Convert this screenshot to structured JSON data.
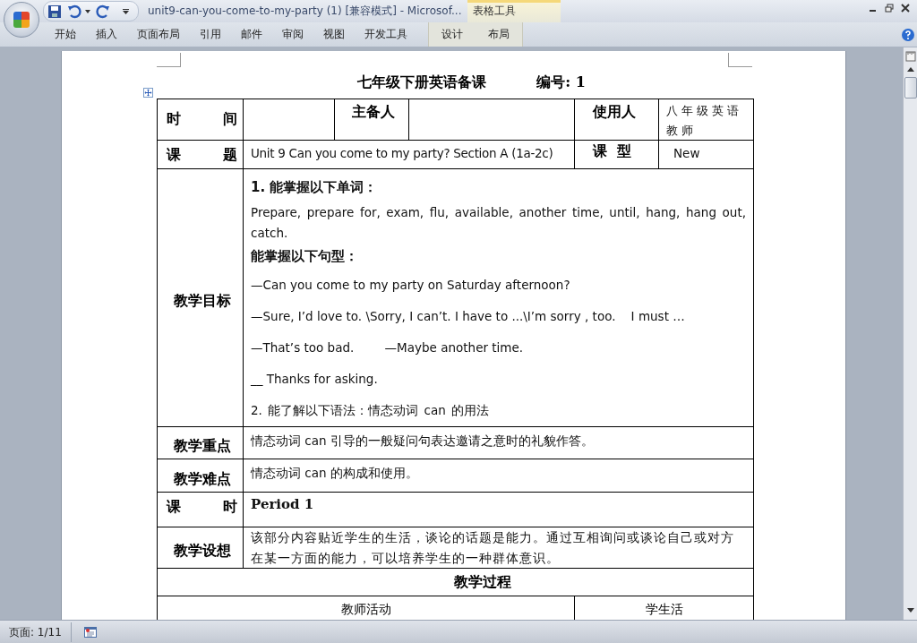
{
  "window": {
    "title": "unit9-can-you-come-to-my-party (1) [兼容模式] - Microsof...",
    "contextual_group": "表格工具"
  },
  "ribbon_tabs": [
    {
      "label": "开始",
      "contextual": false
    },
    {
      "label": "插入",
      "contextual": false
    },
    {
      "label": "页面布局",
      "contextual": false
    },
    {
      "label": "引用",
      "contextual": false
    },
    {
      "label": "邮件",
      "contextual": false
    },
    {
      "label": "审阅",
      "contextual": false
    },
    {
      "label": "视图",
      "contextual": false
    },
    {
      "label": "开发工具",
      "contextual": false
    },
    {
      "label": "设计",
      "contextual": true
    },
    {
      "label": "布局",
      "contextual": true
    }
  ],
  "document": {
    "heading": "七年级下册英语备课",
    "number": "编号: 1",
    "fields": [
      {
        "kind": "spread",
        "label": "时间"
      },
      {
        "kind": "label",
        "label": "主备人"
      },
      {
        "kind": "label",
        "label": "使用人",
        "value": "八年级英语教师"
      },
      {
        "kind": "spread",
        "label": "课题",
        "value": "Unit 9 Can you come to my party? Section A (1a-2c)"
      },
      {
        "kind": "spread",
        "label": "课型",
        "value": "New"
      }
    ],
    "rows": [
      {
        "kind": "wide",
        "cells": [
          {
            "kind": "label",
            "text": "教学目标"
          },
          {
            "kind": "paragraphs",
            "paragraphs": [
              {
                "kind": "bold",
                "text": "1. 能掌握以下单词："
              },
              {
                "kind": "plain",
                "text": "Prepare, prepare for, exam, flu, available, another time, until, hang, hang out, catch."
              },
              {
                "kind": "bold",
                "text": "能掌握以下句型："
              },
              {
                "kind": "spaced",
                "text": "—Can you come to my party on Saturday afternoon?"
              },
              {
                "kind": "spaced",
                "text": "—Sure, I’d love to. \\Sorry, I can’t. I have to ...\\I’m sorry , too.    I must …"
              },
              {
                "kind": "spaced",
                "text": "—That’s too bad.        —Maybe another time."
              },
              {
                "kind": "spaced",
                "text": "__ Thanks for asking."
              },
              {
                "kind": "plain",
                "text": "2. 能了解以下语法：情态动词 can 的用法"
              }
            ]
          }
        ]
      },
      {
        "kind": "wide",
        "cells": [
          {
            "kind": "label",
            "text": "教学重点"
          },
          {
            "kind": "value",
            "text": "情态动词 can 引导的一般疑问句表达邀请之意时的礼貌作答。"
          }
        ]
      },
      {
        "kind": "wide",
        "cells": [
          {
            "kind": "label",
            "text": "教学难点"
          },
          {
            "kind": "value",
            "text": "情态动词 can 的构成和使用。"
          }
        ]
      },
      {
        "kind": "wide",
        "cells": [
          {
            "kind": "spread",
            "text": "课时"
          },
          {
            "kind": "serif",
            "text": "Period 1"
          }
        ]
      },
      {
        "kind": "wide",
        "cells": [
          {
            "kind": "label",
            "text": "教学设想"
          },
          {
            "kind": "value",
            "text": "该部分内容贴近学生的生活，谈论的话题是能力。通过互相询问或谈论自己或对方在某一方面的能力，可以培养学生的一种群体意识。"
          }
        ]
      }
    ],
    "process": {
      "title": "教学过程",
      "columns": [
        "教师活动",
        "学生活"
      ]
    }
  },
  "status_bar": {
    "page": "页面: 1/11"
  }
}
